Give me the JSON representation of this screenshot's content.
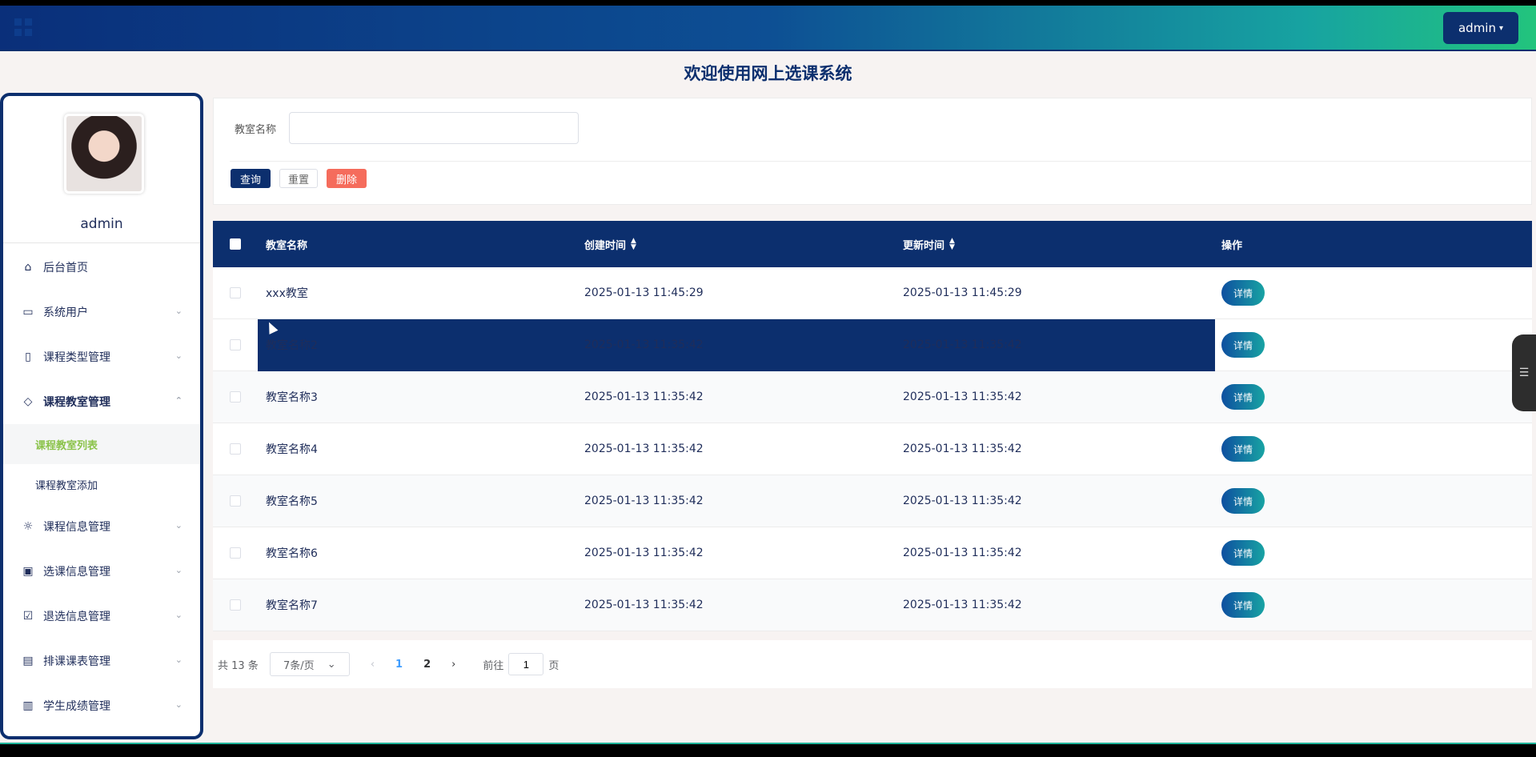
{
  "header": {
    "menu_icon": "grid-icon",
    "user_label": "admin",
    "caret_icon": "chevron-down-icon"
  },
  "page_title": "欢迎使用网上选课系统",
  "sidebar": {
    "username": "admin",
    "items": [
      {
        "label": "后台首页",
        "icon": "home-icon",
        "expandable": false
      },
      {
        "label": "系统用户",
        "icon": "monitor-icon",
        "expandable": true
      },
      {
        "label": "课程类型管理",
        "icon": "bookmark-icon",
        "expandable": true
      },
      {
        "label": "课程教室管理",
        "icon": "tag-icon",
        "expandable": true,
        "open": true
      },
      {
        "label": "课程信息管理",
        "icon": "sun-icon",
        "expandable": true
      },
      {
        "label": "选课信息管理",
        "icon": "inbox-icon",
        "expandable": true
      },
      {
        "label": "退选信息管理",
        "icon": "clipboard-icon",
        "expandable": true
      },
      {
        "label": "排课课表管理",
        "icon": "message-icon",
        "expandable": true
      },
      {
        "label": "学生成绩管理",
        "icon": "archive-icon",
        "expandable": true
      }
    ],
    "submenu": [
      {
        "label": "课程教室列表",
        "active": true
      },
      {
        "label": "课程教室添加",
        "active": false
      }
    ]
  },
  "search": {
    "field_label": "教室名称",
    "field_value": "",
    "query_label": "查询",
    "reset_label": "重置",
    "delete_label": "删除"
  },
  "table": {
    "columns": [
      "教室名称",
      "创建时间",
      "更新时间",
      "操作"
    ],
    "detail_label": "详情",
    "rows": [
      {
        "name": "xxx教室",
        "created": "2025-01-13 11:45:29",
        "updated": "2025-01-13 11:45:29"
      },
      {
        "name": "教室名称2",
        "created": "2025-01-13 11:35:42",
        "updated": "2025-01-13 11:35:42",
        "highlighted": true
      },
      {
        "name": "教室名称3",
        "created": "2025-01-13 11:35:42",
        "updated": "2025-01-13 11:35:42"
      },
      {
        "name": "教室名称4",
        "created": "2025-01-13 11:35:42",
        "updated": "2025-01-13 11:35:42"
      },
      {
        "name": "教室名称5",
        "created": "2025-01-13 11:35:42",
        "updated": "2025-01-13 11:35:42"
      },
      {
        "name": "教室名称6",
        "created": "2025-01-13 11:35:42",
        "updated": "2025-01-13 11:35:42"
      },
      {
        "name": "教室名称7",
        "created": "2025-01-13 11:35:42",
        "updated": "2025-01-13 11:35:42"
      }
    ]
  },
  "pagination": {
    "total_text": "共 13 条",
    "page_size": "7条/页",
    "pages": [
      "1",
      "2"
    ],
    "current_page": "1",
    "goto_prefix": "前往",
    "goto_value": "1",
    "goto_suffix": "页"
  },
  "colors": {
    "primary": "#0c2f6e",
    "accent_green": "#8bc34a",
    "danger": "#f56c5c"
  }
}
